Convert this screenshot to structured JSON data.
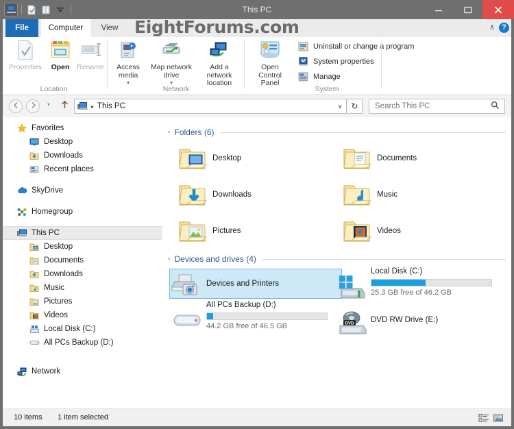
{
  "window": {
    "title": "This PC",
    "watermark": "EightForums.com",
    "minimize_label": "—",
    "maximize_label": "❐",
    "close_label": "✕",
    "close_color": "#e24b4b"
  },
  "quick_access": {
    "items": [
      {
        "name": "this-pc-icon",
        "label": "This PC"
      },
      {
        "name": "properties-icon",
        "label": "Properties"
      },
      {
        "name": "new-folder-icon",
        "label": "New folder"
      },
      {
        "name": "customize-dropdown-icon",
        "label": "Customize Quick Access Toolbar"
      }
    ]
  },
  "ribbon": {
    "tabs": [
      {
        "label": "File",
        "selected": false,
        "is_file": true
      },
      {
        "label": "Computer",
        "selected": true,
        "is_file": false
      },
      {
        "label": "View",
        "selected": false,
        "is_file": false
      }
    ],
    "collapse_label": "∧",
    "help_label": "?",
    "groups": [
      {
        "label": "Location",
        "buttons": [
          {
            "label": "Properties",
            "icon": "properties-icon",
            "state": "disabled"
          },
          {
            "label": "Open",
            "icon": "open-folder-icon",
            "state": "emphasis"
          },
          {
            "label": "Rename",
            "icon": "rename-icon",
            "state": "disabled"
          }
        ]
      },
      {
        "label": "Network",
        "buttons": [
          {
            "label": "Access media",
            "icon": "access-media-icon",
            "state": "normal",
            "dropdown": true
          },
          {
            "label": "Map network drive",
            "icon": "map-network-drive-icon",
            "state": "normal",
            "dropdown": true
          },
          {
            "label": "Add a network location",
            "icon": "add-network-location-icon",
            "state": "normal",
            "dropdown": false
          }
        ]
      },
      {
        "label": "System",
        "buttons": [
          {
            "label": "Open Control Panel",
            "icon": "control-panel-icon",
            "state": "normal",
            "dropdown": false
          }
        ],
        "small_buttons": [
          {
            "label": "Uninstall or change a program",
            "icon": "uninstall-program-icon"
          },
          {
            "label": "System properties",
            "icon": "system-properties-icon"
          },
          {
            "label": "Manage",
            "icon": "manage-icon"
          }
        ]
      }
    ]
  },
  "address_bar": {
    "back_label": "←",
    "forward_label": "→",
    "recent_label": "▾",
    "up_label": "↑",
    "breadcrumb_icon": "this-pc-icon",
    "breadcrumb_separator": "▸",
    "breadcrumb": "This PC",
    "dropdown_label": "∨",
    "refresh_label": "↻",
    "search_placeholder": "Search This PC",
    "search_value": "",
    "search_icon": "search-icon"
  },
  "navigation_pane": {
    "items": [
      {
        "label": "Favorites",
        "icon": "star-icon",
        "level": "root",
        "selected": false
      },
      {
        "label": "Desktop",
        "icon": "desktop-icon",
        "level": "child",
        "selected": false
      },
      {
        "label": "Downloads",
        "icon": "downloads-folder-icon",
        "level": "child",
        "selected": false
      },
      {
        "label": "Recent places",
        "icon": "recent-places-icon",
        "level": "child",
        "selected": false
      },
      {
        "label": "SkyDrive",
        "icon": "skydrive-cloud-icon",
        "level": "root",
        "selected": false
      },
      {
        "label": "Homegroup",
        "icon": "homegroup-icon",
        "level": "root",
        "selected": false
      },
      {
        "label": "This PC",
        "icon": "this-pc-icon",
        "level": "root",
        "selected": true
      },
      {
        "label": "Desktop",
        "icon": "desktop-folder-icon",
        "level": "child",
        "selected": false
      },
      {
        "label": "Documents",
        "icon": "documents-folder-icon",
        "level": "child",
        "selected": false
      },
      {
        "label": "Downloads",
        "icon": "downloads-folder-icon",
        "level": "child",
        "selected": false
      },
      {
        "label": "Music",
        "icon": "music-folder-icon",
        "level": "child",
        "selected": false
      },
      {
        "label": "Pictures",
        "icon": "pictures-folder-icon",
        "level": "child",
        "selected": false
      },
      {
        "label": "Videos",
        "icon": "videos-folder-icon",
        "level": "child",
        "selected": false
      },
      {
        "label": "Local Disk (C:)",
        "icon": "local-disk-icon",
        "level": "child",
        "selected": false
      },
      {
        "label": "All PCs Backup (D:)",
        "icon": "hard-drive-icon",
        "level": "child",
        "selected": false
      },
      {
        "label": "Network",
        "icon": "network-icon",
        "level": "root",
        "selected": false
      }
    ]
  },
  "content": {
    "sections": [
      {
        "header": "Folders (6)",
        "expanded": true,
        "items": [
          {
            "label": "Desktop",
            "icon": "desktop-folder-icon"
          },
          {
            "label": "Documents",
            "icon": "documents-folder-icon"
          },
          {
            "label": "Downloads",
            "icon": "downloads-folder-icon"
          },
          {
            "label": "Music",
            "icon": "music-folder-icon"
          },
          {
            "label": "Pictures",
            "icon": "pictures-folder-icon"
          },
          {
            "label": "Videos",
            "icon": "videos-folder-icon"
          }
        ]
      },
      {
        "header": "Devices and drives (4)",
        "expanded": true,
        "items": [
          {
            "label": "Devices and Printers",
            "icon": "devices-and-printers-icon",
            "selected": true,
            "has_bar": false
          },
          {
            "label": "Local Disk (C:)",
            "icon": "windows-local-disk-icon",
            "selected": false,
            "has_bar": true,
            "used_percent": 45,
            "free_text": "25.3 GB free of 46.2 GB",
            "bar_color": "#1a9fe0"
          },
          {
            "label": "All PCs Backup (D:)",
            "icon": "hard-drive-icon",
            "selected": false,
            "has_bar": true,
            "used_percent": 5,
            "free_text": "44.2 GB free of 46.5 GB",
            "bar_color": "#1a9fe0"
          },
          {
            "label": "DVD RW Drive (E:)",
            "icon": "dvd-drive-icon",
            "selected": false,
            "has_bar": false
          }
        ]
      }
    ]
  },
  "status_bar": {
    "item_count": "10 items",
    "selection": "1 item selected",
    "view_buttons": [
      {
        "name": "details-view-button",
        "label": "Details view",
        "active": false
      },
      {
        "name": "large-icons-view-button",
        "label": "Large icons view",
        "active": false
      }
    ]
  }
}
